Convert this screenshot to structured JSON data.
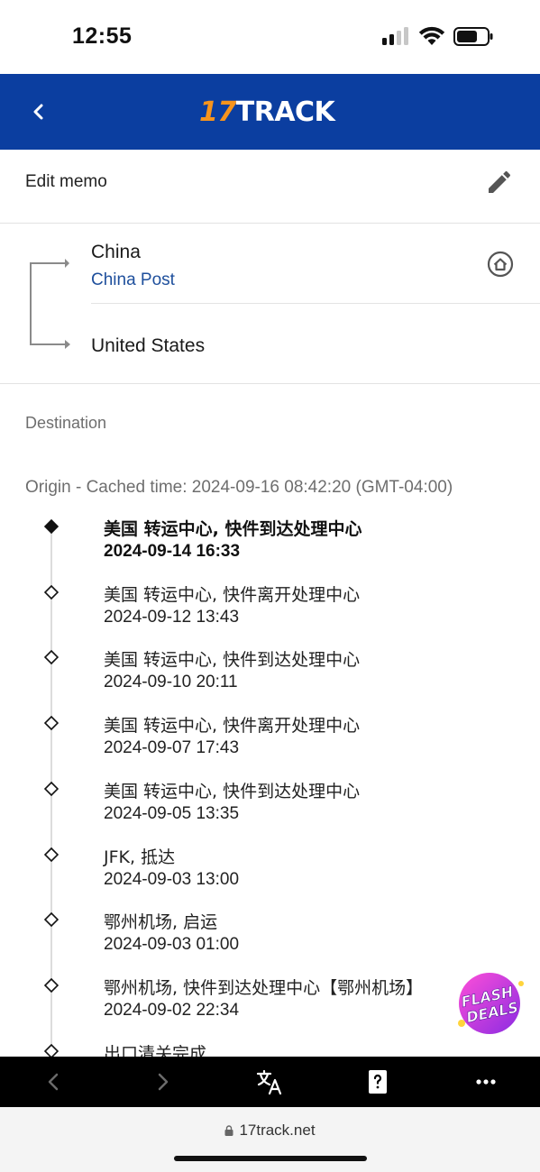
{
  "status_bar": {
    "time": "12:55"
  },
  "header": {
    "logo_number": "17",
    "logo_word": "TRACK"
  },
  "memo": {
    "label": "Edit memo"
  },
  "route": {
    "origin_country": "China",
    "carrier": "China Post",
    "destination_country": "United States"
  },
  "sections": {
    "destination_label": "Destination",
    "origin_cache": "Origin - Cached time: 2024-09-16 08:42:20 (GMT-04:00)"
  },
  "events": [
    {
      "description": "美国 转运中心, 快件到达处理中心",
      "time": "2024-09-14 16:33",
      "latest": true
    },
    {
      "description": "美国 转运中心, 快件离开处理中心",
      "time": "2024-09-12 13:43"
    },
    {
      "description": "美国 转运中心, 快件到达处理中心",
      "time": "2024-09-10 20:11"
    },
    {
      "description": "美国 转运中心, 快件离开处理中心",
      "time": "2024-09-07 17:43"
    },
    {
      "description": "美国 转运中心, 快件到达处理中心",
      "time": "2024-09-05 13:35"
    },
    {
      "description": "JFK, 抵达",
      "time": "2024-09-03 13:00"
    },
    {
      "description": "鄂州机场, 启运",
      "time": "2024-09-03 01:00"
    },
    {
      "description": "鄂州机场, 快件到达处理中心【鄂州机场】",
      "time": "2024-09-02 22:34"
    },
    {
      "description": "出口清关完成",
      "time": ""
    }
  ],
  "badge": {
    "line1": "FLASH",
    "line2": "DEALS"
  },
  "browser": {
    "url": "17track.net"
  },
  "colors": {
    "header_bg": "#0b3ea0",
    "logo_accent": "#f7941d",
    "carrier_link": "#1e4f9c"
  },
  "icons": [
    "back-chevron-icon",
    "pencil-icon",
    "home-icon",
    "translate-icon",
    "help-card-icon",
    "more-icon",
    "lock-icon"
  ]
}
